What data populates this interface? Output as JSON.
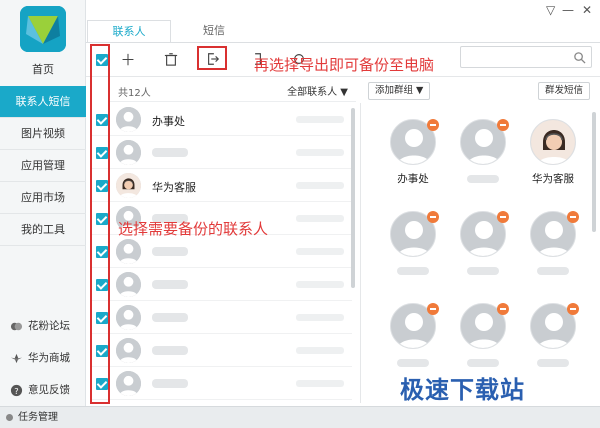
{
  "sidebar": {
    "items": [
      {
        "label": "首页"
      },
      {
        "label": "联系人短信"
      },
      {
        "label": "图片视频"
      },
      {
        "label": "应用管理"
      },
      {
        "label": "应用市场"
      },
      {
        "label": "我的工具"
      }
    ],
    "active_index": 1,
    "links": [
      {
        "label": "花粉论坛",
        "icon": "forum-icon"
      },
      {
        "label": "华为商城",
        "icon": "huawei-logo-icon"
      },
      {
        "label": "意见反馈",
        "icon": "question-icon"
      }
    ]
  },
  "tabs": [
    {
      "label": "联系人"
    },
    {
      "label": "短信"
    }
  ],
  "toolbar": {
    "icons": [
      "add-icon",
      "delete-icon",
      "export-icon",
      "import-icon",
      "refresh-icon",
      "search-icon"
    ]
  },
  "list": {
    "count": "共12人",
    "filter": "全部联系人 ▼",
    "contacts": [
      {
        "name": "办事处"
      },
      {
        "name": ""
      },
      {
        "name": "华为客服"
      },
      {
        "name": ""
      },
      {
        "name": ""
      },
      {
        "name": ""
      },
      {
        "name": ""
      },
      {
        "name": ""
      },
      {
        "name": ""
      }
    ]
  },
  "right": {
    "add_group": "添加群组 ▼",
    "group_sms": "群发短信",
    "cards": [
      {
        "name": "办事处"
      },
      {
        "name": ""
      },
      {
        "name": "华为客服"
      },
      {
        "name": ""
      },
      {
        "name": ""
      },
      {
        "name": ""
      },
      {
        "name": ""
      },
      {
        "name": ""
      },
      {
        "name": ""
      }
    ]
  },
  "annotations": {
    "top": "再选择导出即可备份至电脑",
    "middle": "选择需要备份的联系人"
  },
  "statusbar": {
    "label": "任务管理"
  },
  "watermark": "极速下载站",
  "colors": {
    "accent": "#1aa9c9",
    "annotation": "#e23a3a",
    "remove_badge": "#f07a3a"
  }
}
